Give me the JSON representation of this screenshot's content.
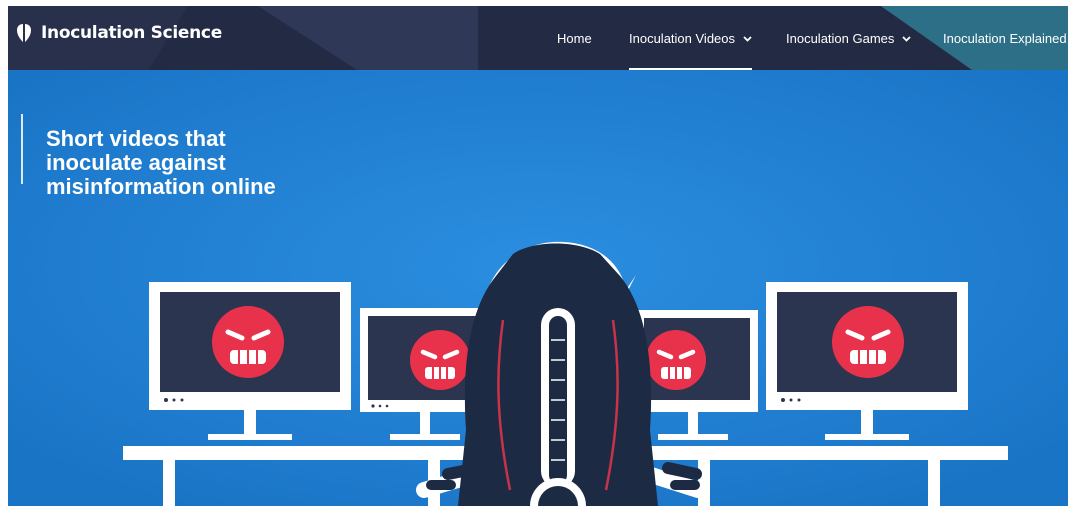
{
  "brand": {
    "name": "Inoculation Science",
    "logo_icon": "shield-icon"
  },
  "nav": {
    "items": [
      {
        "label": "Home",
        "has_dropdown": false,
        "active": false
      },
      {
        "label": "Inoculation Videos",
        "has_dropdown": true,
        "active": true
      },
      {
        "label": "Inoculation Games",
        "has_dropdown": true,
        "active": false
      },
      {
        "label": "Inoculation Explained",
        "has_dropdown": false,
        "active": false
      }
    ]
  },
  "hero": {
    "title_lines": [
      "Short videos that",
      "inoculate against",
      "misinformation online"
    ],
    "illustration": "angry-monitors-thermometer-chair"
  },
  "colors": {
    "header_bg": "#232a44",
    "header_accent": "#2d6f86",
    "hero_bg": "#1f7fd0",
    "angry_face": "#e8324c",
    "chair": "#1d2a44",
    "text": "#ffffff"
  }
}
